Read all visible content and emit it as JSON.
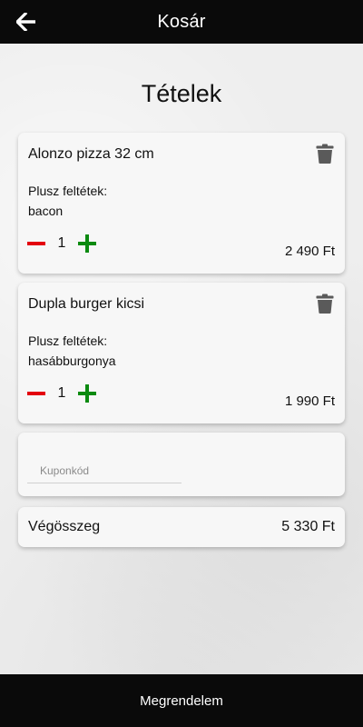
{
  "header": {
    "title": "Kosár",
    "back_icon": "arrow-left-icon"
  },
  "section_title": "Tételek",
  "items": [
    {
      "name": "Alonzo pizza 32 cm",
      "extras_label": "Plusz feltétek:",
      "extras": "bacon",
      "quantity": "1",
      "price": "2 490 Ft"
    },
    {
      "name": "Dupla burger kicsi",
      "extras_label": "Plusz feltétek:",
      "extras": "hasábburgonya",
      "quantity": "1",
      "price": "1 990 Ft"
    }
  ],
  "coupon": {
    "placeholder": "Kuponkód",
    "value": ""
  },
  "total": {
    "label": "Végösszeg",
    "value": "5 330 Ft"
  },
  "order_button": {
    "label": "Megrendelem"
  },
  "colors": {
    "bar": "#0a0a0a",
    "minus": "#e3000f",
    "plus": "#0b8a10",
    "trash": "#5a5a5a"
  }
}
